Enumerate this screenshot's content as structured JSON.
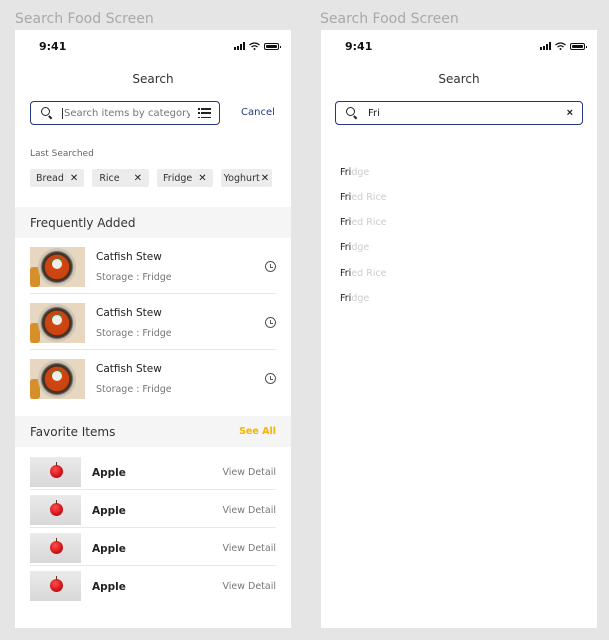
{
  "frames": [
    {
      "title": "Search Food Screen",
      "status": {
        "time": "9:41"
      },
      "screen_title": "Search",
      "search": {
        "placeholder": "Search items by category...",
        "cancel": "Cancel"
      },
      "last_searched": {
        "label": "Last Searched",
        "chips": [
          "Bread",
          "Rice",
          "Fridge",
          "Yoghurt"
        ]
      },
      "frequently_added": {
        "title": "Frequently Added",
        "items": [
          {
            "name": "Catfish Stew",
            "meta": "Storage : Fridge"
          },
          {
            "name": "Catfish Stew",
            "meta": "Storage : Fridge"
          },
          {
            "name": "Catfish Stew",
            "meta": "Storage : Fridge"
          }
        ]
      },
      "favorite_items": {
        "title": "Favorite Items",
        "see_all": "See All",
        "items": [
          {
            "name": "Apple",
            "action": "View Detail"
          },
          {
            "name": "Apple",
            "action": "View Detail"
          },
          {
            "name": "Apple",
            "action": "View Detail"
          },
          {
            "name": "Apple",
            "action": "View Detail"
          }
        ]
      }
    },
    {
      "title": "Search Food Screen",
      "status": {
        "time": "9:41"
      },
      "screen_title": "Search",
      "search": {
        "value": "Fri",
        "clear": "×"
      },
      "suggestions": [
        {
          "match": "Fri",
          "rest": "dge"
        },
        {
          "match": "Fri",
          "rest": "ed Rice"
        },
        {
          "match": "Fri",
          "rest": "ed Rice"
        },
        {
          "match": "Fri",
          "rest": "dge"
        },
        {
          "match": "Fri",
          "rest": "ed Rice"
        },
        {
          "match": "Fri",
          "rest": "dge"
        }
      ]
    }
  ],
  "colors": {
    "accent": "#23387f",
    "see_all": "#f4b400",
    "band": "#f5f5f5",
    "canvas": "#e5e5e5"
  },
  "icons": [
    "search-icon",
    "filter-icon",
    "close-icon",
    "clock-icon",
    "signal-icon",
    "wifi-icon",
    "battery-icon"
  ]
}
